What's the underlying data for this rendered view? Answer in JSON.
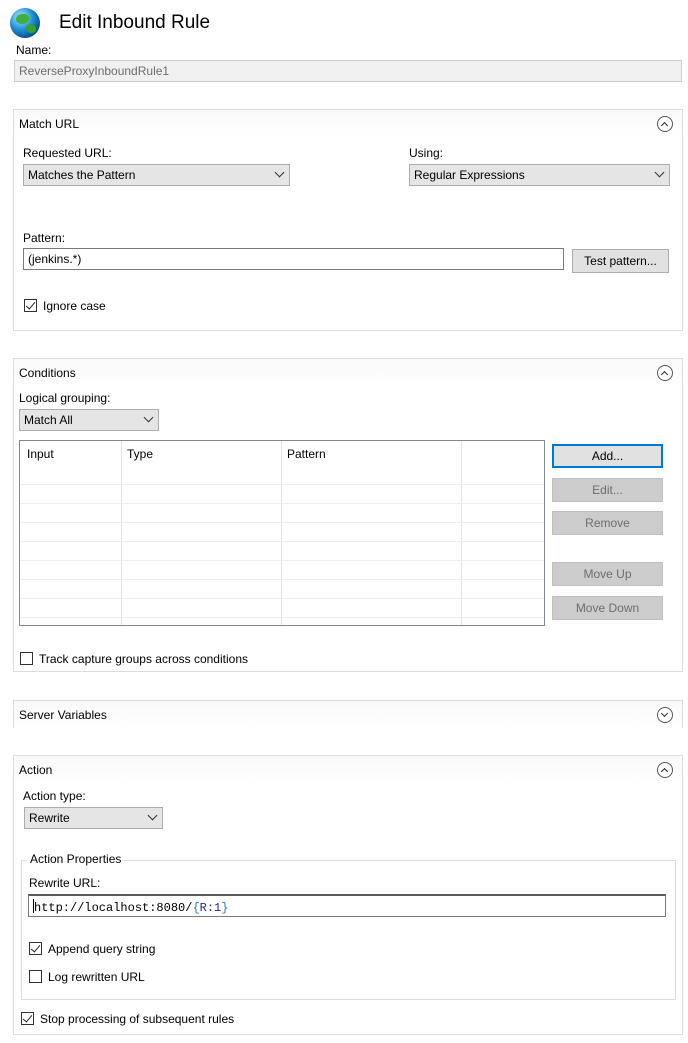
{
  "header": {
    "title": "Edit Inbound Rule",
    "icon": "globe-icon"
  },
  "name": {
    "label": "Name:",
    "value": "ReverseProxyInboundRule1"
  },
  "match_url": {
    "title": "Match URL",
    "requested_url_label": "Requested URL:",
    "requested_url_value": "Matches the Pattern",
    "using_label": "Using:",
    "using_value": "Regular Expressions",
    "pattern_label": "Pattern:",
    "pattern_value": "(jenkins.*)",
    "test_pattern_button": "Test pattern...",
    "ignore_case_label": "Ignore case",
    "ignore_case_checked": true
  },
  "conditions": {
    "title": "Conditions",
    "logical_grouping_label": "Logical grouping:",
    "logical_grouping_value": "Match All",
    "columns": [
      "Input",
      "Type",
      "Pattern"
    ],
    "rows": [],
    "buttons": {
      "add": "Add...",
      "edit": "Edit...",
      "remove": "Remove",
      "move_up": "Move Up",
      "move_down": "Move Down"
    },
    "track_capture_label": "Track capture groups across conditions",
    "track_capture_checked": false
  },
  "server_variables": {
    "title": "Server Variables",
    "expanded": false
  },
  "action": {
    "title": "Action",
    "action_type_label": "Action type:",
    "action_type_value": "Rewrite",
    "properties_legend": "Action Properties",
    "rewrite_url_label": "Rewrite URL:",
    "rewrite_url_prefix": "http://localhost:8080/",
    "rewrite_url_open": "{",
    "rewrite_url_var": "R:1",
    "rewrite_url_close": "}",
    "append_query_label": "Append query string",
    "append_query_checked": true,
    "log_rewritten_label": "Log rewritten URL",
    "log_rewritten_checked": false,
    "stop_processing_label": "Stop processing of subsequent rules",
    "stop_processing_checked": true
  }
}
